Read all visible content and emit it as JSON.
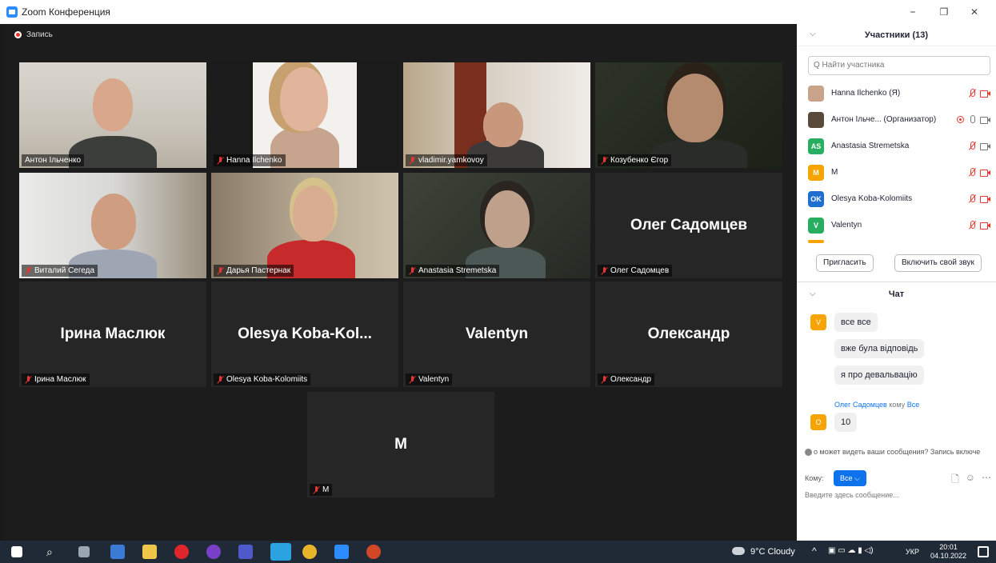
{
  "window": {
    "title": "Zoom Конференция",
    "minimize": "–",
    "maximize": "❐",
    "close": "✕"
  },
  "recording": {
    "label": "Запись"
  },
  "tiles": [
    {
      "name": "Антон Ільченко",
      "video": true,
      "active": true,
      "muted": false
    },
    {
      "name": "Hanna Ilchenko",
      "video": true,
      "muted": true
    },
    {
      "name": "vladimir.yamkovoy",
      "video": true,
      "muted": true
    },
    {
      "name": "Козубенко Єгор",
      "video": true,
      "muted": true
    },
    {
      "name": "Виталий Сегеда",
      "video": true,
      "muted": true
    },
    {
      "name": "Дарья Пастернак",
      "video": true,
      "muted": true
    },
    {
      "name": "Anastasia Stremetska",
      "video": true,
      "muted": true
    },
    {
      "name": "Олег Садомцев",
      "display": "Олег Садомцев",
      "video": false,
      "muted": true
    },
    {
      "name": "Ірина Маслюк",
      "display": "Ірина Маслюк",
      "video": false,
      "muted": true
    },
    {
      "name": "Olesya Koba-Kolomiits",
      "display": "Olesya  Koba-Kol...",
      "video": false,
      "muted": true
    },
    {
      "name": "Valentyn",
      "display": "Valentyn",
      "video": false,
      "muted": true
    },
    {
      "name": "Олександр",
      "display": "Олександр",
      "video": false,
      "muted": true
    },
    {
      "name": "M",
      "display": "M",
      "video": false,
      "muted": true
    }
  ],
  "participants": {
    "title": "Участники (13)",
    "search_placeholder": "Q Найти участника",
    "list": [
      {
        "initials": "",
        "name": "Hanna Ilchenko (Я)",
        "color": "#c9a38a",
        "mic": "off",
        "cam": "off",
        "rec": false
      },
      {
        "initials": "",
        "name": "Антон Ільче...  (Организатор)",
        "color": "#5a4a3a",
        "mic": "on",
        "cam": "on",
        "rec": true
      },
      {
        "initials": "AS",
        "name": "Anastasia Stremetska",
        "color": "#27ae60",
        "mic": "off",
        "cam": "on",
        "rec": false
      },
      {
        "initials": "M",
        "name": "M",
        "color": "#f7a400",
        "mic": "off",
        "cam": "off",
        "rec": false
      },
      {
        "initials": "OK",
        "name": "Olesya Koba-Kolomiits",
        "color": "#1f6fd1",
        "mic": "off",
        "cam": "off",
        "rec": false
      },
      {
        "initials": "V",
        "name": "Valentyn",
        "color": "#27ae60",
        "mic": "off",
        "cam": "off",
        "rec": false
      }
    ],
    "invite_label": "Пригласить",
    "unmute_label": "Включить свой звук"
  },
  "chat": {
    "title": "Чат",
    "messages": [
      {
        "avatar": "V",
        "text": "все все"
      },
      {
        "text": "вже була відповідь"
      },
      {
        "text": "я про девальвацію"
      },
      {
        "avatar": "O",
        "sender": "Олег Садомцев",
        "to_word": "кому",
        "to": "Все",
        "text": "10"
      }
    ],
    "notice": "о может видеть ваши сообщения? Запись включе",
    "to_label": "Кому:",
    "to_value": "Все",
    "input_placeholder": "Введите здесь сообщение..."
  },
  "taskbar": {
    "weather": "9°C  Cloudy",
    "lang": "УКР",
    "time": "20:01",
    "date": "04.10.2022"
  },
  "colors": {
    "accent": "#0e72ed",
    "active_speaker": "#b8e36b",
    "muted": "#e8362e"
  }
}
